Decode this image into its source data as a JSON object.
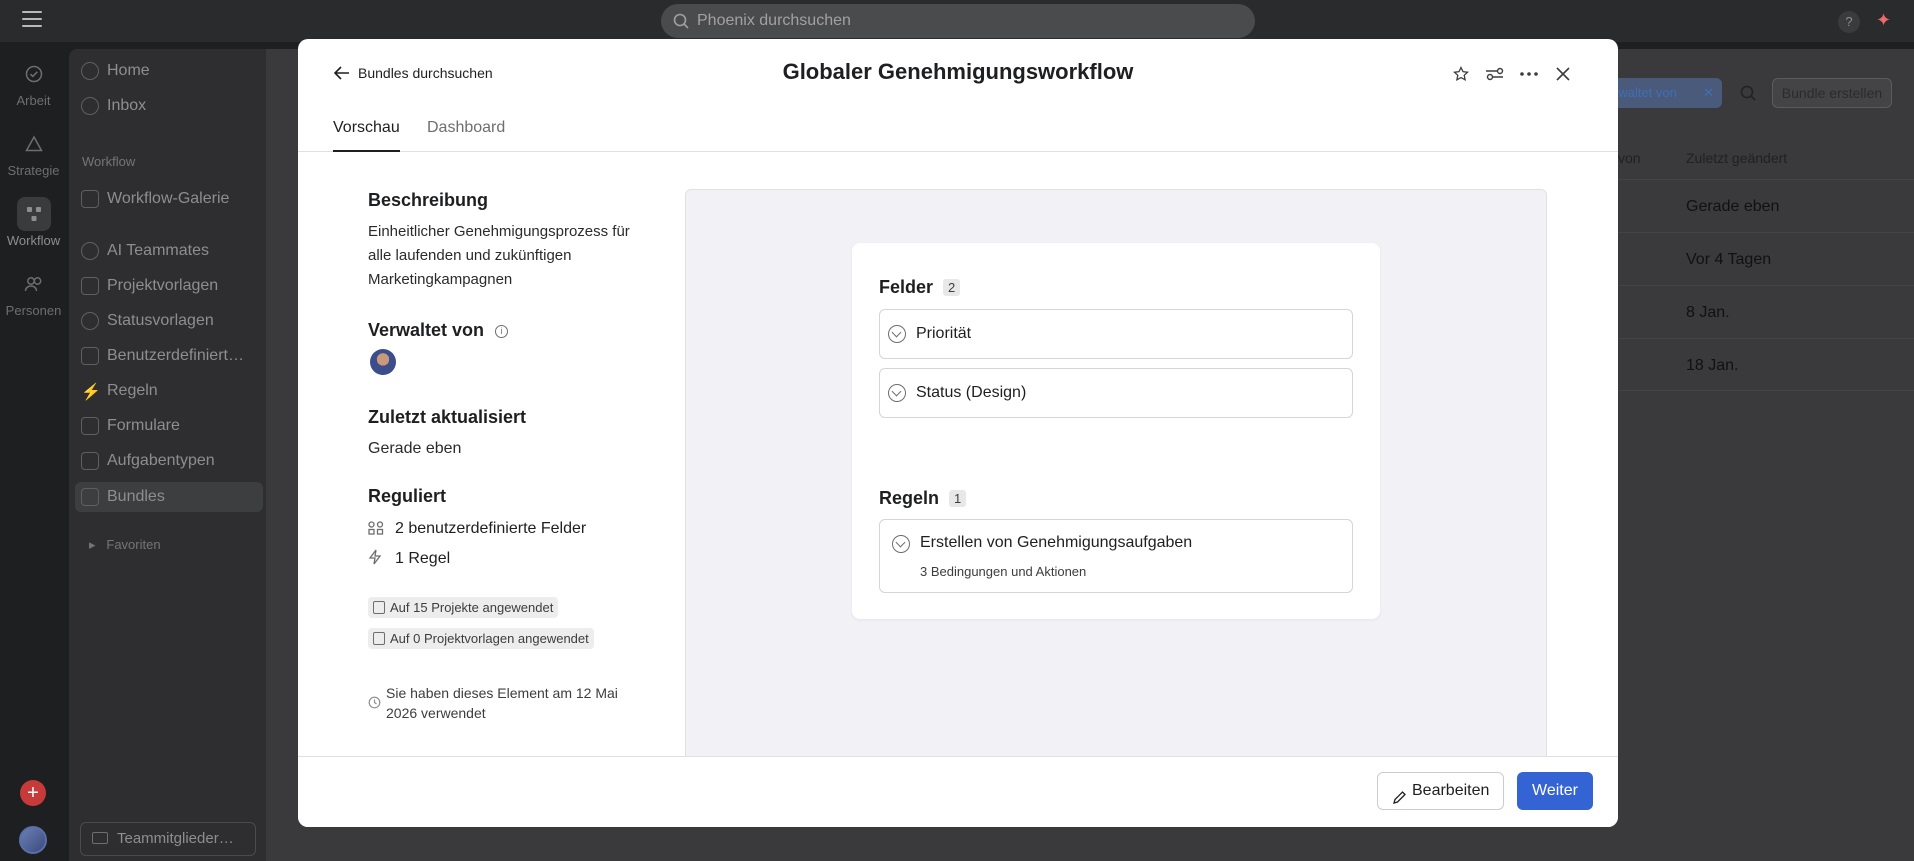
{
  "topbar": {
    "search_placeholder": "Phoenix durchsuchen",
    "help": "?"
  },
  "rail": {
    "items": [
      {
        "label": "Arbeit"
      },
      {
        "label": "Strategie"
      },
      {
        "label": "Workflow"
      },
      {
        "label": "Personen"
      }
    ]
  },
  "sidebar": {
    "home": "Home",
    "inbox": "Inbox",
    "workflow_heading": "Workflow",
    "items": [
      "Workflow-Galerie",
      "AI Teammates",
      "Projektvorlagen",
      "Statusvorlagen",
      "Benutzerdefiniert…",
      "Regeln",
      "Formulare",
      "Aufgabentypen",
      "Bundles"
    ],
    "favorites": "Favoriten",
    "invite": "Teammitglieder…"
  },
  "background": {
    "filter_chip": "rwaltet von",
    "create_button": "Bundle erstellen",
    "col_von": "von",
    "col_changed": "Zuletzt geändert",
    "rows": [
      "Gerade eben",
      "Vor 4 Tagen",
      "8 Jan.",
      "18 Jan."
    ]
  },
  "modal": {
    "back_label": "Bundles durchsuchen",
    "title": "Globaler Genehmigungsworkflow",
    "tabs": [
      "Vorschau",
      "Dashboard"
    ],
    "description_heading": "Beschreibung",
    "description": "Einheitlicher Genehmigungsprozess für alle laufenden und zukünftigen Marketingkampagnen",
    "managed_heading": "Verwaltet von",
    "updated_heading": "Zuletzt aktualisiert",
    "updated_value": "Gerade eben",
    "governed_heading": "Reguliert",
    "governed_fields": "2 benutzerdefinierte Felder",
    "governed_rules": "1 Regel",
    "badge_projects": "Auf 15 Projekte angewendet",
    "badge_templates": "Auf 0 Projektvorlagen angewendet",
    "used_note": "Sie haben dieses Element am 12 Mai 2026 verwendet",
    "preview": {
      "fields_title": "Felder",
      "fields_count": "2",
      "fields": [
        "Priorität",
        "Status (Design)"
      ],
      "rules_title": "Regeln",
      "rules_count": "1",
      "rule_name": "Erstellen von Genehmigungsaufgaben",
      "rule_sub": "3 Bedingungen und Aktionen"
    },
    "edit_button": "Bearbeiten",
    "next_button": "Weiter"
  }
}
